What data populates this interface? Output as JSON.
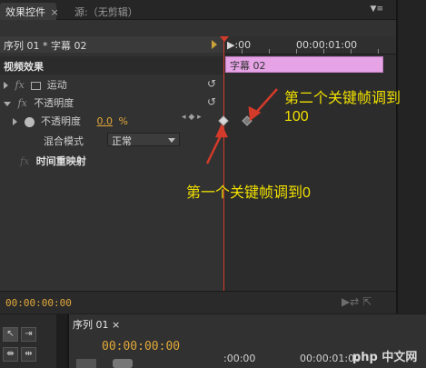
{
  "tabs": {
    "effect_controls": "效果控件",
    "effect_controls_close": "×",
    "source": "源:（无剪辑）"
  },
  "panel_menu": "▼≡",
  "sequence_header": "序列 01 * 字幕 02",
  "tree": {
    "video_effects": "视频效果",
    "motion": "运动",
    "opacity": "不透明度",
    "opacity_param": "不透明度",
    "opacity_value": "0.0",
    "opacity_unit": "%",
    "blend_mode_label": "混合模式",
    "blend_mode_value": "正常",
    "time_remap": "时间重映射",
    "fx": "fx",
    "reset": "↺"
  },
  "keyframe_nav": "◂ ◆ ▸",
  "ruler": {
    "start": "▶:00",
    "end": "00:00:01:00"
  },
  "clip": {
    "name": "字幕 02",
    "color": "#e6a3e6"
  },
  "annotations": {
    "second_keyframe_line1": "第二个关键帧调到",
    "second_keyframe_line2": "100",
    "first_keyframe": "第一个关键帧调到0",
    "color": "#f0e000"
  },
  "footer": {
    "timecode": "00:00:00:00",
    "icons": "▶⇄ ⇱"
  },
  "sequence_panel": {
    "tab": "序列 01 ×",
    "timecode": "00:00:00:00",
    "ruler_start": ":00:00",
    "ruler_end": "00:00:01:00"
  },
  "watermark": "php 中文网",
  "colors": {
    "playhead": "#d43a2a",
    "timecode": "#e3a93a"
  }
}
